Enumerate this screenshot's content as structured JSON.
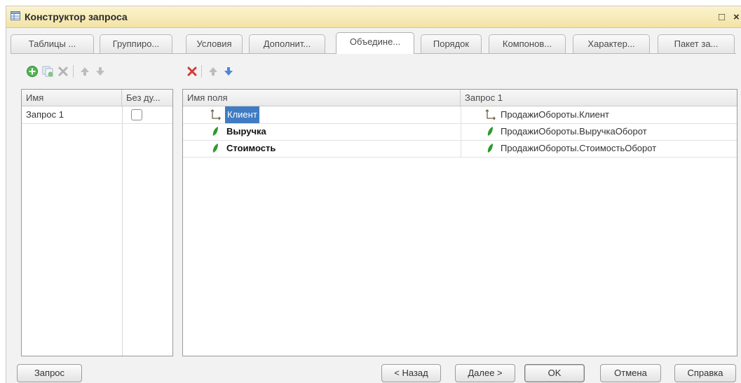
{
  "window": {
    "title": "Конструктор запроса",
    "maximize_glyph": "□",
    "close_glyph": "×"
  },
  "tabs": [
    {
      "label": "Таблицы ...",
      "active": false
    },
    {
      "label": "Группиро...",
      "active": false
    },
    {
      "label": "Условия",
      "active": false
    },
    {
      "label": "Дополнит...",
      "active": false
    },
    {
      "label": "Объедине...",
      "active": true
    },
    {
      "label": "Порядок",
      "active": false
    },
    {
      "label": "Компонов...",
      "active": false
    },
    {
      "label": "Характер...",
      "active": false
    },
    {
      "label": "Пакет за...",
      "active": false
    }
  ],
  "left_panel": {
    "toolbar_icons": [
      "add-icon",
      "copy-icon",
      "delete-icon",
      "move-up-icon",
      "move-down-icon"
    ],
    "columns": [
      "Имя",
      "Без ду..."
    ],
    "rows": [
      {
        "name": "Запрос 1",
        "no_duplicates": false
      }
    ]
  },
  "right_panel": {
    "toolbar_icons": [
      "delete-icon",
      "move-up-icon",
      "move-down-icon"
    ],
    "columns": [
      "Имя поля",
      "Запрос 1"
    ],
    "rows": [
      {
        "field": "Клиент",
        "source": "ПродажиОбороты.Клиент",
        "icon": "dimension-icon",
        "selected": true
      },
      {
        "field": "Выручка",
        "source": "ПродажиОбороты.ВыручкаОборот",
        "icon": "resource-icon",
        "selected": false
      },
      {
        "field": "Стоимость",
        "source": "ПродажиОбороты.СтоимостьОборот",
        "icon": "resource-icon",
        "selected": false
      }
    ]
  },
  "buttons": {
    "query": "Запрос",
    "back": "< Назад",
    "next": "Далее >",
    "ok": "OK",
    "cancel": "Отмена",
    "help": "Справка"
  },
  "colors": {
    "title_bar": "#f2e3a4",
    "selection": "#3f7cc3",
    "resource_green": "#2e9a2e",
    "delete_red": "#d23a3a",
    "arrow_blue": "#4f86d6"
  }
}
